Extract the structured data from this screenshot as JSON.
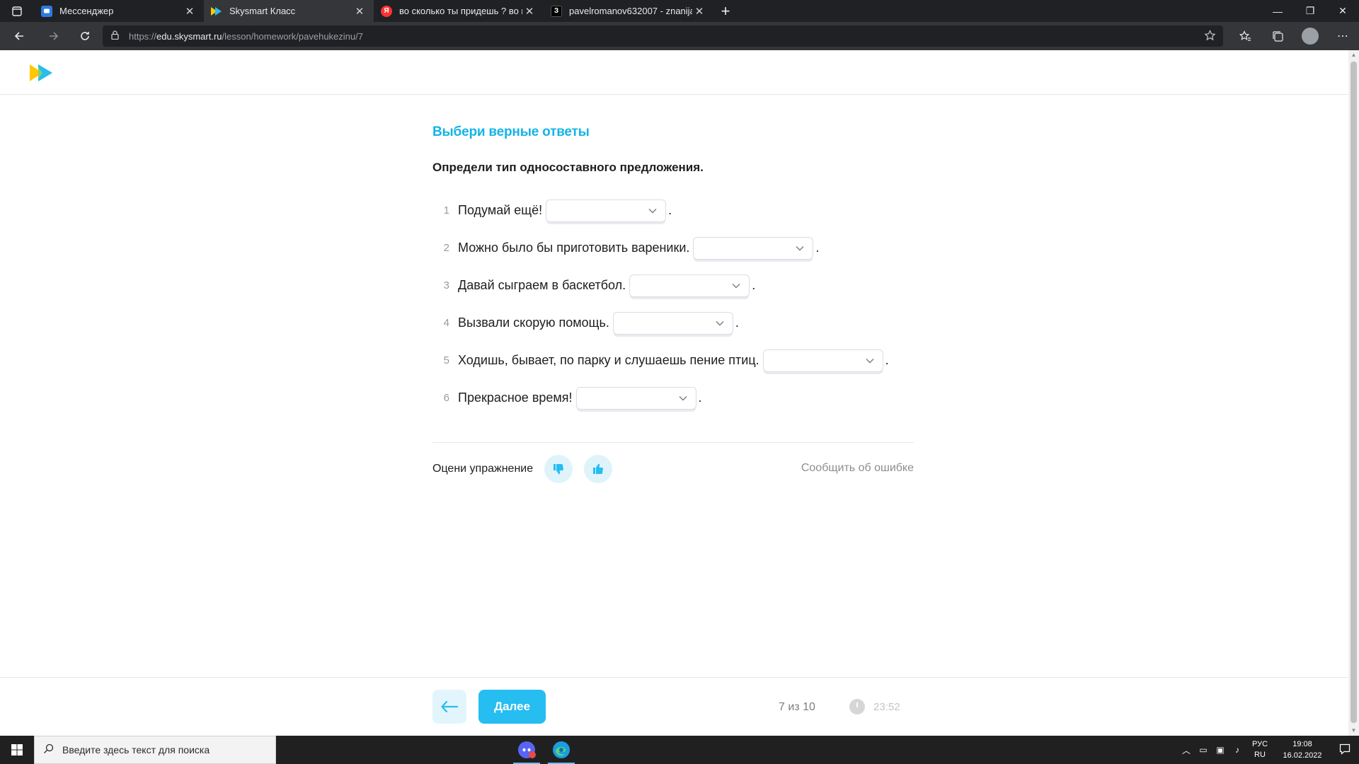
{
  "browser": {
    "tabs": [
      {
        "title": "Мессенджер",
        "active": false
      },
      {
        "title": "Skysmart Класс",
        "active": true
      },
      {
        "title": "во сколько ты придешь ? во вс",
        "active": false
      },
      {
        "title": "pavelromanov632007 - znanija.c",
        "active": false
      }
    ],
    "url_scheme": "https://",
    "url_host": "edu.skysmart.ru",
    "url_path": "/lesson/homework/pavehukezinu/7"
  },
  "task": {
    "title": "Выбери верные ответы",
    "question": "Определи тип односоставного предложения.",
    "items": [
      {
        "num": "1",
        "text": "Подумай ещё!",
        "value": ""
      },
      {
        "num": "2",
        "text": "Можно было бы приготовить вареники.",
        "value": ""
      },
      {
        "num": "3",
        "text": "Давай сыграем в баскетбол.",
        "value": ""
      },
      {
        "num": "4",
        "text": "Вызвали скорую помощь.",
        "value": ""
      },
      {
        "num": "5",
        "text": "Ходишь, бывает, по парку и слушаешь пение птиц.",
        "value": ""
      },
      {
        "num": "6",
        "text": "Прекрасное время!",
        "value": ""
      }
    ],
    "punct": "."
  },
  "rating": {
    "label": "Оцени упражнение",
    "report": "Сообщить об ошибке"
  },
  "footer": {
    "next_label": "Далее",
    "progress": "7 из 10",
    "timer": "23:52"
  },
  "taskbar": {
    "search_placeholder": "Введите здесь текст для поиска",
    "lang_top": "РУС",
    "lang_bottom": "RU",
    "time": "19:08",
    "date": "16.02.2022"
  },
  "colors": {
    "accent": "#14b4e6",
    "button": "#26bdf0",
    "logo_yellow": "#ffc700",
    "logo_blue": "#26bdf0"
  }
}
